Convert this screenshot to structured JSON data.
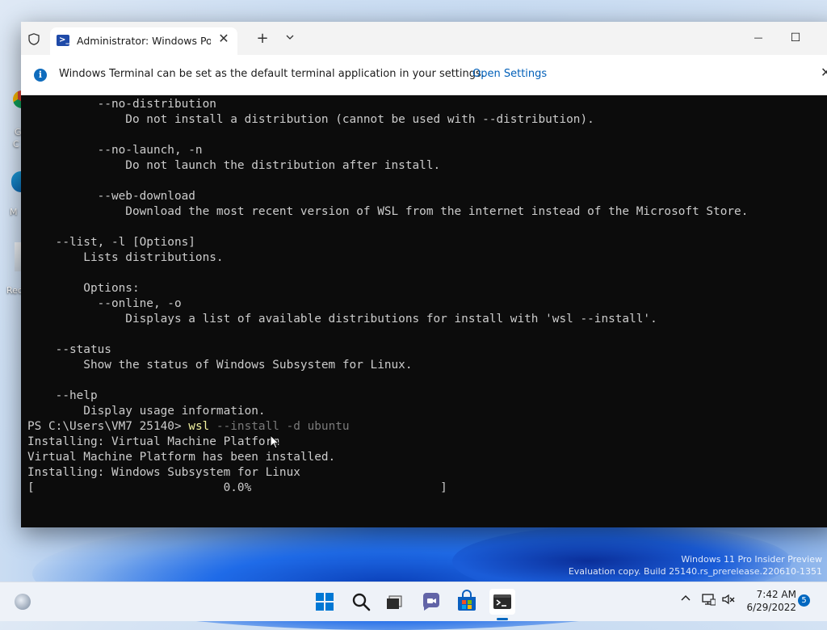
{
  "window": {
    "tab_title": "Administrator: Windows PowerShell",
    "new_tab_label": "+",
    "close_tab_label": "✕",
    "minimize_label": "—",
    "maximize_label": "☐"
  },
  "infobar": {
    "message": "Windows Terminal can be set as the default terminal application in your settings.",
    "link": "Open Settings",
    "close_label": "✕"
  },
  "console": {
    "lines": [
      "          --no-distribution",
      "              Do not install a distribution (cannot be used with --distribution).",
      "",
      "          --no-launch, -n",
      "              Do not launch the distribution after install.",
      "",
      "          --web-download",
      "              Download the most recent version of WSL from the internet instead of the Microsoft Store.",
      "",
      "    --list, -l [Options]",
      "        Lists distributions.",
      "",
      "        Options:",
      "          --online, -o",
      "              Displays a list of available distributions for install with 'wsl --install'.",
      "",
      "    --status",
      "        Show the status of Windows Subsystem for Linux.",
      "",
      "    --help",
      "        Display usage information."
    ],
    "prompt": "PS C:\\Users\\VM7 25140> ",
    "command": "wsl",
    "command_args": " --install -d ubuntu",
    "output": [
      "Installing: Virtual Machine Platform",
      "Virtual Machine Platform has been installed.",
      "Installing: Windows Subsystem for Linux",
      "[                           0.0%                           ]"
    ],
    "progress": 0.0
  },
  "desktop": {
    "icon_labels": [
      "G",
      "C",
      "M",
      "Rec"
    ]
  },
  "watermark": {
    "line1": "Windows 11 Pro Insider Preview",
    "line2": "Evaluation copy. Build 25140.rs_prerelease.220610-1351"
  },
  "taskbar": {
    "time": "7:42 AM",
    "date": "6/29/2022",
    "notification_count": "5",
    "apps": [
      "start-icon",
      "search-icon",
      "task-view-icon",
      "chat-icon",
      "store-icon",
      "terminal-icon"
    ]
  },
  "colors": {
    "terminal_bg": "#0c0c0c",
    "terminal_fg": "#cccccc",
    "command": "#f2f2a0",
    "accent": "#005fb8"
  }
}
